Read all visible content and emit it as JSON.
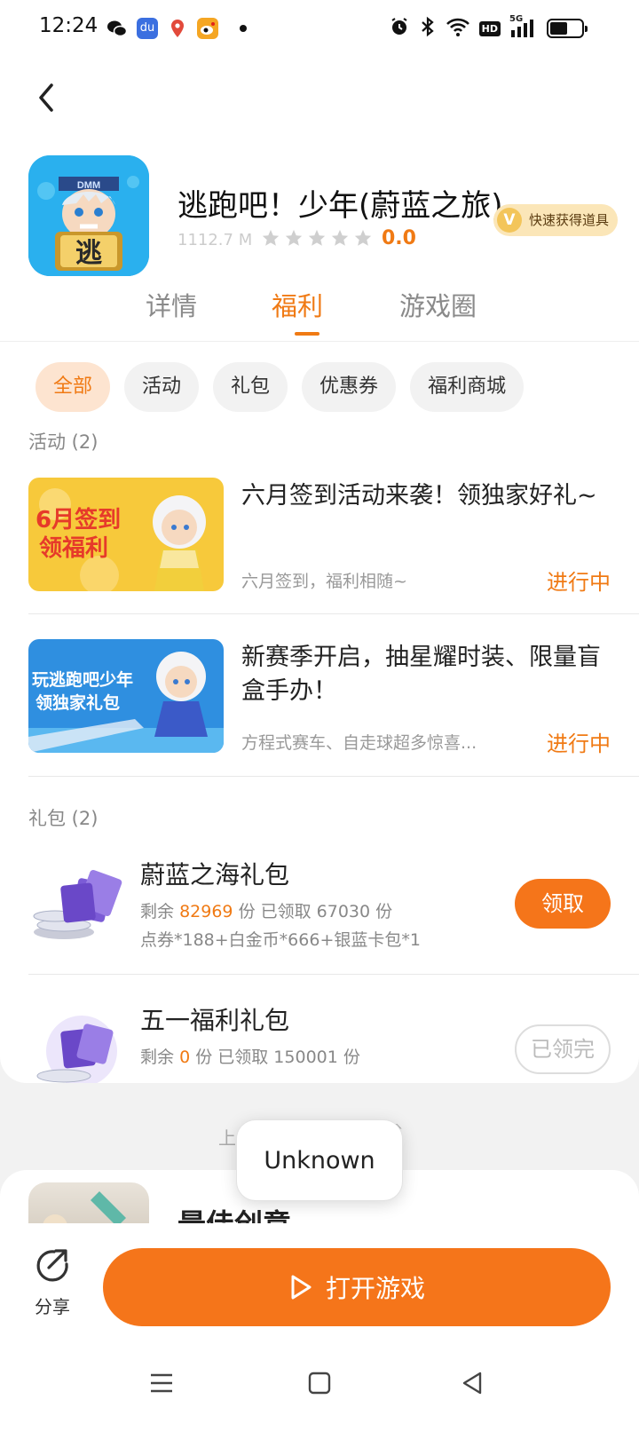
{
  "status_bar": {
    "time": "12:24",
    "network": "5G",
    "hd_label": "HD",
    "battery_level": 0.6
  },
  "header": {
    "back_icon": "chevron-left-icon"
  },
  "game": {
    "title": "逃跑吧！少年(蔚蓝之旅)",
    "size": "1112.7 M",
    "rating": "0.0",
    "stars": 0,
    "fast_badge": "快速获得道具",
    "icon_text": "逃",
    "icon_brand": "DMM"
  },
  "tabs": [
    {
      "label": "详情"
    },
    {
      "label": "福利"
    },
    {
      "label": "游戏圈"
    }
  ],
  "filters": [
    {
      "label": "全部"
    },
    {
      "label": "活动"
    },
    {
      "label": "礼包"
    },
    {
      "label": "优惠券"
    },
    {
      "label": "福利商城"
    }
  ],
  "activities_section": {
    "title": "活动 (2)",
    "items": [
      {
        "image_text": "6月签到 领福利",
        "title": "六月签到活动来袭！领独家好礼~",
        "subtitle": "六月签到，福利相随~",
        "status": "进行中"
      },
      {
        "image_text": "玩逃跑吧少年 领独家礼包",
        "title": "新赛季开启，抽星耀时装、限量盲盒手办！",
        "subtitle": "方程式赛车、自走球超多惊喜...",
        "status": "进行中"
      }
    ]
  },
  "gifts_section": {
    "title": "礼包 (2)",
    "items": [
      {
        "title": "蔚蓝之海礼包",
        "remaining_label": "剩余",
        "remaining": "82969",
        "unit": "份",
        "claimed_text": "已领取 67030 份",
        "content": "点券*188+白金币*666+银蓝卡包*1",
        "button": "领取"
      },
      {
        "title": "五一福利礼包",
        "remaining_label": "剩余",
        "remaining": "0",
        "unit": "份",
        "claimed_text": "已领取 150001 份",
        "content": "",
        "button": "已领完"
      }
    ]
  },
  "below": {
    "text": "上",
    "caret": "^",
    "peek_title": "最佳创意"
  },
  "tooltip": {
    "text": "Unknown"
  },
  "bottom": {
    "share_label": "分享",
    "open_label": "打开游戏"
  },
  "colors": {
    "accent": "#f07a14",
    "button": "#f5751a"
  }
}
